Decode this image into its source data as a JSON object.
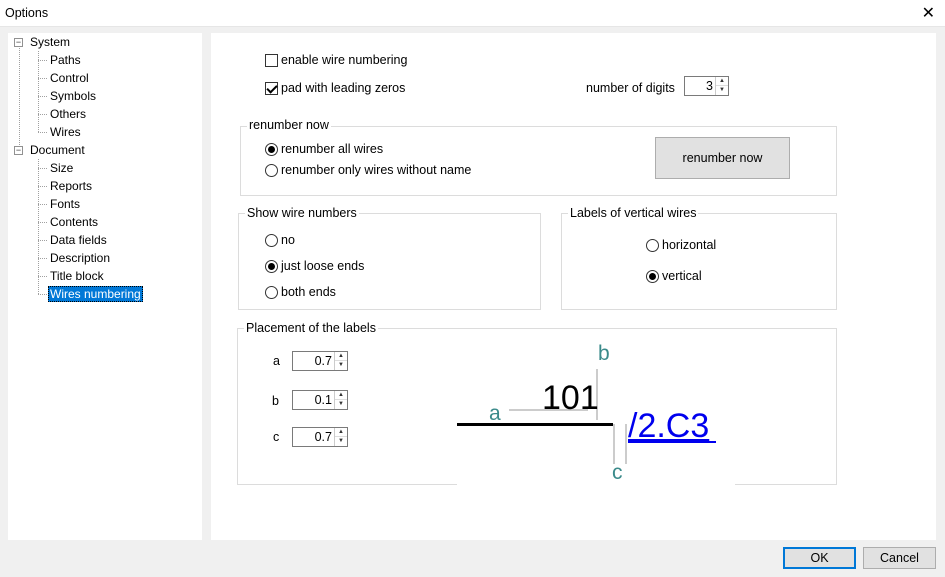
{
  "window": {
    "title": "Options",
    "close_glyph": "✕"
  },
  "tree": {
    "system": {
      "label": "System",
      "children": [
        "Paths",
        "Control",
        "Symbols",
        "Others",
        "Wires"
      ]
    },
    "document": {
      "label": "Document",
      "children": [
        "Size",
        "Reports",
        "Fonts",
        "Contents",
        "Data fields",
        "Description",
        "Title block",
        "Wires numbering"
      ]
    },
    "selected": "Wires numbering"
  },
  "options": {
    "enable_wire_numbering": {
      "label": "enable wire numbering",
      "checked": false
    },
    "pad_leading_zeros": {
      "label": "pad with leading zeros",
      "checked": true
    },
    "number_of_digits": {
      "label": "number of digits",
      "value": "3"
    }
  },
  "renumber_group": {
    "title": "renumber now",
    "all_wires": "renumber all wires",
    "only_without_name": "renumber only wires without name",
    "selected": "all_wires",
    "button": "renumber now"
  },
  "show_wire_numbers": {
    "title": "Show wire numbers",
    "options": [
      "no",
      "just loose ends",
      "both ends"
    ],
    "selected": "just loose ends"
  },
  "vertical_labels": {
    "title": "Labels of vertical wires",
    "options": [
      "horizontal",
      "vertical"
    ],
    "selected": "vertical"
  },
  "placement": {
    "title": "Placement of the labels",
    "a": {
      "label": "a",
      "value": "0.7"
    },
    "b": {
      "label": "b",
      "value": "0.1"
    },
    "c": {
      "label": "c",
      "value": "0.7"
    },
    "preview": {
      "wire_number": "101",
      "reference": "/2.C3",
      "label_a": "a",
      "label_b": "b",
      "label_c": "c"
    }
  },
  "footer": {
    "ok": "OK",
    "cancel": "Cancel"
  },
  "colors": {
    "accent": "#0078d7",
    "link": "#0000ee",
    "dimension": "#3a8a8a"
  }
}
